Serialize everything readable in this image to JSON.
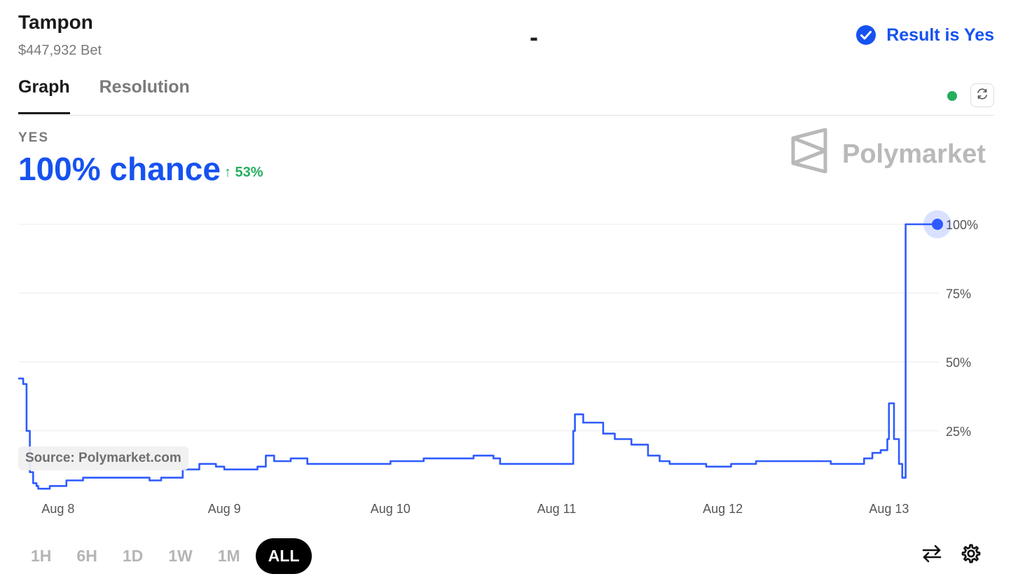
{
  "market": {
    "title": "Tampon",
    "volume": "$447,932 Bet",
    "dash": "-",
    "result": "Result is Yes"
  },
  "tabs": [
    {
      "label": "Graph",
      "active": true
    },
    {
      "label": "Resolution",
      "active": false
    }
  ],
  "outcome": {
    "label": "YES",
    "chance": "100% chance",
    "change": "↑ 53%"
  },
  "brand": "Polymarket",
  "source_note": "Source: Polymarket.com",
  "time_ranges": [
    {
      "label": "1H",
      "active": false
    },
    {
      "label": "6H",
      "active": false
    },
    {
      "label": "1D",
      "active": false
    },
    {
      "label": "1W",
      "active": false
    },
    {
      "label": "1M",
      "active": false
    },
    {
      "label": "ALL",
      "active": true
    }
  ],
  "icons": {
    "result": "check-circle-icon",
    "refresh": "refresh-icon",
    "swap": "swap-arrows-icon",
    "settings": "gear-icon",
    "brand": "polymarket-logo-icon"
  },
  "colors": {
    "accent": "#1652f0",
    "positive": "#27ae60",
    "line": "#2e5bff"
  },
  "chart_data": {
    "type": "line",
    "title": "",
    "xlabel": "",
    "ylabel": "",
    "ylim": [
      0,
      100
    ],
    "y_ticks": [
      25,
      50,
      75,
      100
    ],
    "y_tick_labels": [
      "25%",
      "50%",
      "75%",
      "100%"
    ],
    "x_ticks": [
      1,
      2,
      3,
      4,
      5,
      6
    ],
    "x_tick_labels": [
      "Aug 8",
      "Aug 9",
      "Aug 10",
      "Aug 11",
      "Aug 12",
      "Aug 13"
    ],
    "xlim": [
      0.76,
      6.3
    ],
    "grid": true,
    "series": [
      {
        "x": [
          0.76,
          0.79,
          0.81,
          0.82,
          0.83,
          0.85,
          0.87,
          0.88,
          0.95,
          1.05,
          1.15,
          1.35,
          1.55,
          1.62,
          1.75,
          1.85,
          1.95,
          2.0,
          2.2,
          2.25,
          2.3,
          2.4,
          2.5,
          2.55,
          2.75,
          2.95,
          3.0,
          3.2,
          3.3,
          3.5,
          3.62,
          3.66,
          3.9,
          4.08,
          4.1,
          4.11,
          4.16,
          4.28,
          4.35,
          4.45,
          4.55,
          4.62,
          4.68,
          4.78,
          4.9,
          5.05,
          5.2,
          5.35,
          5.55,
          5.65,
          5.75,
          5.85,
          5.9,
          5.95,
          5.99,
          6.0,
          6.03,
          6.06,
          6.08,
          6.1,
          6.3
        ],
        "y": [
          44,
          42,
          25,
          25,
          10,
          6,
          5,
          4,
          5,
          7,
          8,
          8,
          7,
          8,
          11,
          13,
          12,
          11,
          12,
          16,
          14,
          15,
          13,
          13,
          13,
          13,
          14,
          15,
          15,
          16,
          15,
          13,
          13,
          13,
          25,
          31,
          28,
          24,
          22,
          20,
          16,
          14,
          13,
          13,
          12,
          13,
          14,
          14,
          14,
          13,
          13,
          15,
          17,
          18,
          22,
          35,
          22,
          13,
          8,
          100,
          100
        ]
      }
    ]
  }
}
